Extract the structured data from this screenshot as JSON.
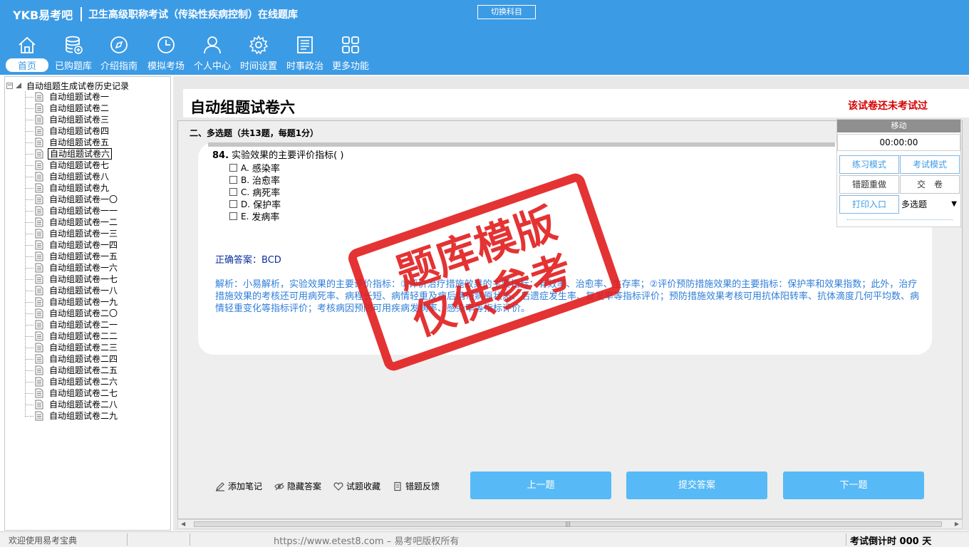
{
  "header": {
    "logo": "YKB易考吧",
    "title": "卫生高级职称考试（传染性疾病控制）在线题库",
    "switch_label": "切换科目",
    "nav": [
      {
        "label": "首页",
        "icon": "home-icon"
      },
      {
        "label": "已购题库",
        "icon": "database-icon"
      },
      {
        "label": "介绍指南",
        "icon": "compass-icon"
      },
      {
        "label": "模拟考场",
        "icon": "clock-icon"
      },
      {
        "label": "个人中心",
        "icon": "user-icon"
      },
      {
        "label": "时间设置",
        "icon": "gear-icon"
      },
      {
        "label": "时事政治",
        "icon": "news-icon"
      },
      {
        "label": "更多功能",
        "icon": "grid-icon"
      }
    ]
  },
  "tree": {
    "root": "自动组题生成试卷历史记录",
    "selected_index": 5,
    "items": [
      "自动组题试卷一",
      "自动组题试卷二",
      "自动组题试卷三",
      "自动组题试卷四",
      "自动组题试卷五",
      "自动组题试卷六",
      "自动组题试卷七",
      "自动组题试卷八",
      "自动组题试卷九",
      "自动组题试卷一〇",
      "自动组题试卷一一",
      "自动组题试卷一二",
      "自动组题试卷一三",
      "自动组题试卷一四",
      "自动组题试卷一五",
      "自动组题试卷一六",
      "自动组题试卷一七",
      "自动组题试卷一八",
      "自动组题试卷一九",
      "自动组题试卷二〇",
      "自动组题试卷二一",
      "自动组题试卷二二",
      "自动组题试卷二三",
      "自动组题试卷二四",
      "自动组题试卷二五",
      "自动组题试卷二六",
      "自动组题试卷二七",
      "自动组题试卷二八",
      "自动组题试卷二九"
    ]
  },
  "paper": {
    "title": "自动组题试卷六",
    "status": "该试卷还未考试过",
    "section": "二、多选题（共13题，每题1分）"
  },
  "question": {
    "number": "84.",
    "text": "实验效果的主要评价指标( )",
    "options": [
      {
        "letter": "A.",
        "text": "感染率"
      },
      {
        "letter": "B.",
        "text": "治愈率"
      },
      {
        "letter": "C.",
        "text": "病死率"
      },
      {
        "letter": "D.",
        "text": "保护率"
      },
      {
        "letter": "E.",
        "text": "发病率"
      }
    ],
    "answer": "正确答案：BCD",
    "analysis": "解析：小易解析，实验效果的主要评价指标：①评价治疗措施效果的主要指标：有效率、治愈率、生存率；②评价预防措施效果的主要指标：保护率和效果指数；此外，治疗措施效果的考核还可用病死率、病程长短、病情轻重及病后携带病原状态、后遗症发生率、复发率等指标评价；预防措施效果考核可用抗体阳转率、抗体滴度几何平均数、病情轻重变化等指标评价；考核病因预防可用疾病发病率、感染率等指标评价。"
  },
  "tools": [
    {
      "label": "添加笔记",
      "icon": "pencil-icon"
    },
    {
      "label": "隐藏答案",
      "icon": "eye-icon"
    },
    {
      "label": "试题收藏",
      "icon": "heart-icon"
    },
    {
      "label": "错题反馈",
      "icon": "feedback-icon"
    }
  ],
  "buttons": {
    "prev": "上一题",
    "submit": "提交答案",
    "next": "下一题"
  },
  "panel": {
    "move": "移动",
    "timer": "00:00:00",
    "practice": "练习模式",
    "exam": "考试模式",
    "redo": "错题重做",
    "hand_in": "交　卷",
    "print": "打印入口",
    "type": "多选题"
  },
  "stamp": {
    "line1": "题库模版",
    "line2": "仅供参考"
  },
  "status": {
    "welcome": "欢迎使用易考宝典",
    "copyright": "https://www.etest8.com – 易考吧版权所有",
    "countdown": "考试倒计时 000 天"
  },
  "colors": {
    "header": "#3c9be5",
    "button": "#57baf6",
    "answer": "#0b2f9e",
    "analysis": "#2f7ed8",
    "warning": "#d60000",
    "stamp": "#e21d1d"
  }
}
